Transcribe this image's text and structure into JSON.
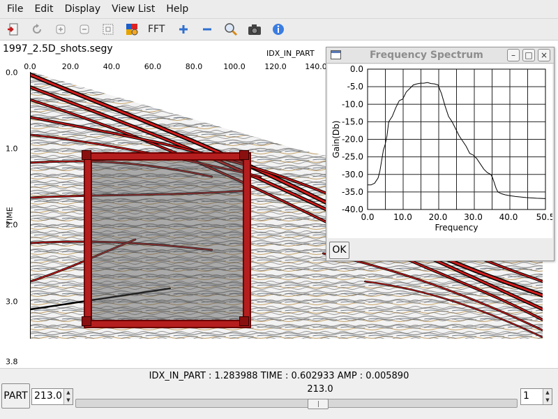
{
  "menu": [
    "File",
    "Edit",
    "Display",
    "View List",
    "Help"
  ],
  "toolbar": {
    "icons": [
      "exit-icon",
      "refresh-icon",
      "zoom-fit-icon",
      "zoom-out-box-icon",
      "select-region-icon",
      "color-palette-icon"
    ],
    "fft_label": "FFT"
  },
  "plot": {
    "file_title": "1997_2.5D_shots.segy",
    "x_axis_name": "IDX_IN_PART",
    "y_axis_name": "TIME",
    "x_ticks": [
      "0.0",
      "20.0",
      "40.0",
      "60.0",
      "80.0",
      "100.0",
      "120.0",
      "140.0"
    ],
    "y_ticks": [
      "0.0",
      "1.0",
      "2.0",
      "3.0",
      "3.8"
    ]
  },
  "dialog": {
    "title": "Frequency Spectrum",
    "ok_label": "OK",
    "minimize": "–",
    "maximize": "□",
    "close": "×"
  },
  "chart_data": {
    "type": "line",
    "title": "",
    "xlabel": "Frequency",
    "ylabel": "Gain(Db)",
    "xlim": [
      0.0,
      50.5
    ],
    "ylim": [
      -40.0,
      0.0
    ],
    "x_ticks": [
      "0.0",
      "10.0",
      "20.0",
      "30.0",
      "40.0",
      "50.5"
    ],
    "y_ticks": [
      "0.0",
      "-5.0",
      "-10.0",
      "-15.0",
      "-20.0",
      "-25.0",
      "-30.0",
      "-35.0",
      "-40.0"
    ],
    "grid": true,
    "series": [
      {
        "name": "",
        "x": [
          0.0,
          1.0,
          2.0,
          3.0,
          3.5,
          4.0,
          4.5,
          5.0,
          5.5,
          6.0,
          7.0,
          8.0,
          9.0,
          10.0,
          11.0,
          12.0,
          13.0,
          14.0,
          15.0,
          16.0,
          17.0,
          18.0,
          19.0,
          20.0,
          21.0,
          22.0,
          23.0,
          24.0,
          25.0,
          26.0,
          27.0,
          28.0,
          29.0,
          30.0,
          31.0,
          32.0,
          33.0,
          34.0,
          35.0,
          35.5,
          36.0,
          36.5,
          37.0,
          38.0,
          39.0,
          40.0,
          42.0,
          45.0,
          48.0,
          50.5
        ],
        "values": [
          -33.0,
          -33.0,
          -32.5,
          -31.0,
          -29.0,
          -26.0,
          -23.0,
          -21.5,
          -19.0,
          -15.0,
          -13.5,
          -11.0,
          -9.0,
          -8.5,
          -6.5,
          -5.5,
          -4.5,
          -4.2,
          -4.0,
          -4.0,
          -3.8,
          -4.1,
          -4.2,
          -4.5,
          -7.0,
          -10.5,
          -13.5,
          -15.0,
          -17.0,
          -19.0,
          -20.5,
          -22.0,
          -24.0,
          -24.5,
          -25.5,
          -27.0,
          -28.5,
          -29.5,
          -30.0,
          -31.0,
          -32.5,
          -34.0,
          -35.0,
          -35.5,
          -35.8,
          -36.0,
          -36.3,
          -36.6,
          -36.8,
          -36.9
        ]
      }
    ]
  },
  "status_line": "IDX_IN_PART : 1.283988  TIME : 0.602933  AMP : 0.005890",
  "bottom": {
    "part_label": "PART",
    "part_value": "213.0",
    "slider_value": "213.0",
    "slider_position": 0.55,
    "step_value": "1"
  }
}
